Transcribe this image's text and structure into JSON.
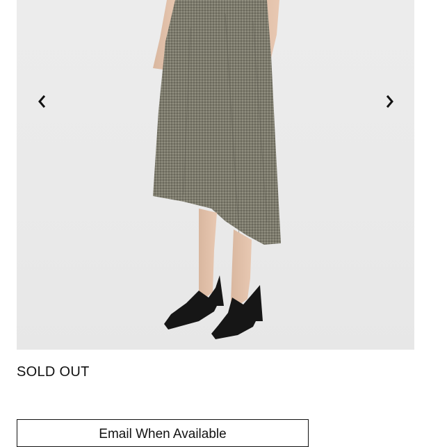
{
  "product": {
    "stock_status": "SOLD OUT",
    "notify_button_label": "Email When Available"
  },
  "gallery": {
    "prev_icon": "chevron-left-icon",
    "next_icon": "chevron-right-icon"
  },
  "colors": {
    "background": "#ffffff",
    "photo_background": "#eaeaea",
    "text": "#111111",
    "button_border": "#111111"
  }
}
